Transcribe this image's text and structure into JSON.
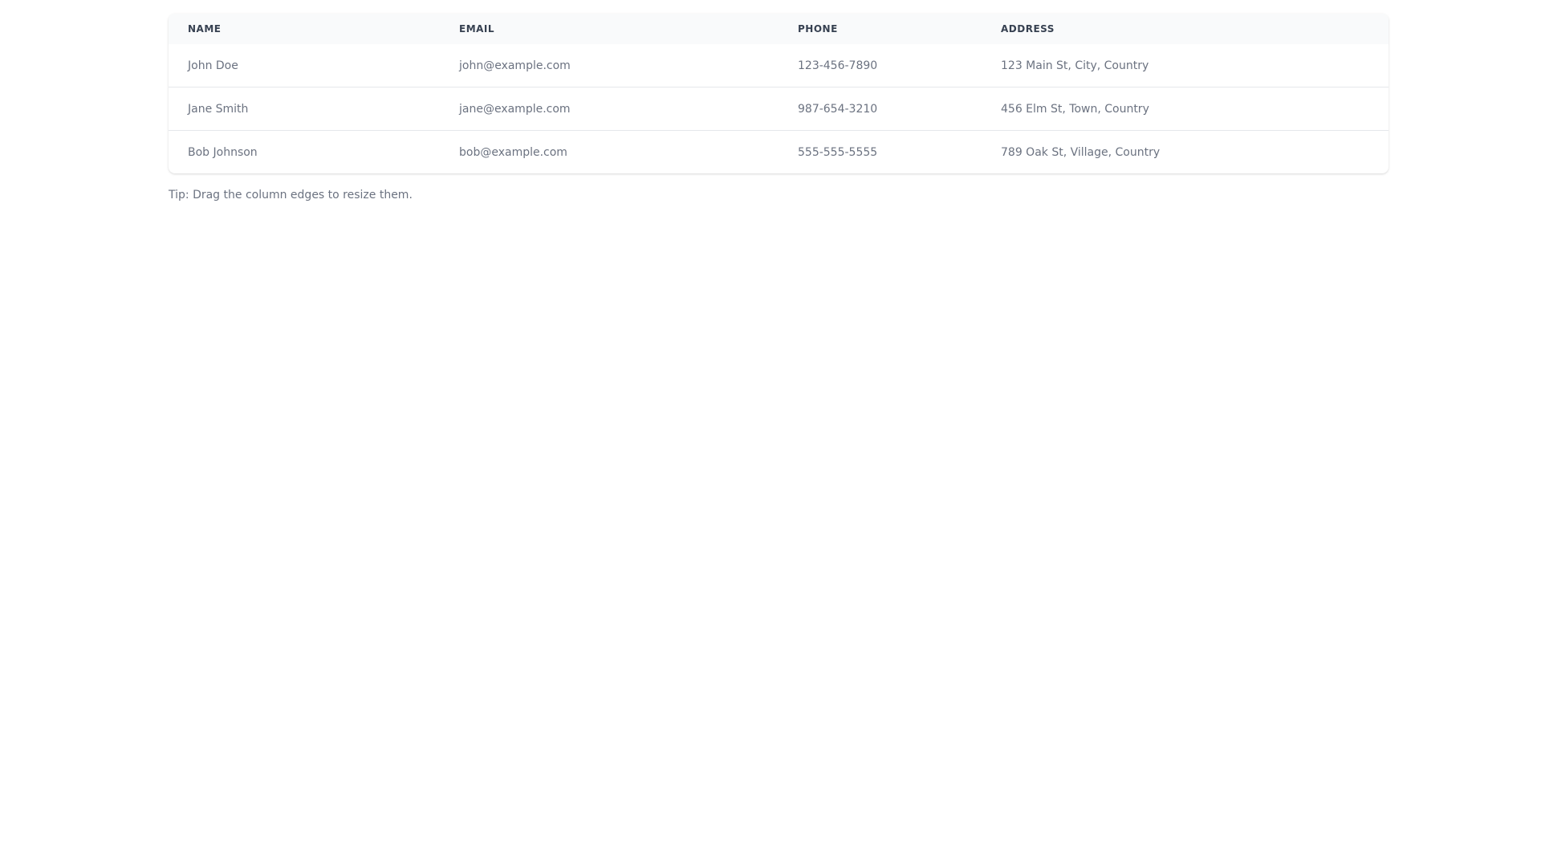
{
  "table": {
    "headers": [
      "NAME",
      "EMAIL",
      "PHONE",
      "ADDRESS"
    ],
    "rows": [
      [
        "John Doe",
        "john@example.com",
        "123-456-7890",
        "123 Main St, City, Country"
      ],
      [
        "Jane Smith",
        "jane@example.com",
        "987-654-3210",
        "456 Elm St, Town, Country"
      ],
      [
        "Bob Johnson",
        "bob@example.com",
        "555-555-5555",
        "789 Oak St, Village, Country"
      ]
    ]
  },
  "tip": "Tip: Drag the column edges to resize them.",
  "colors": {
    "header_bg": "#f9fafb",
    "header_text": "#374151",
    "cell_text": "#6b7280",
    "row_border": "#e5e7eb"
  }
}
